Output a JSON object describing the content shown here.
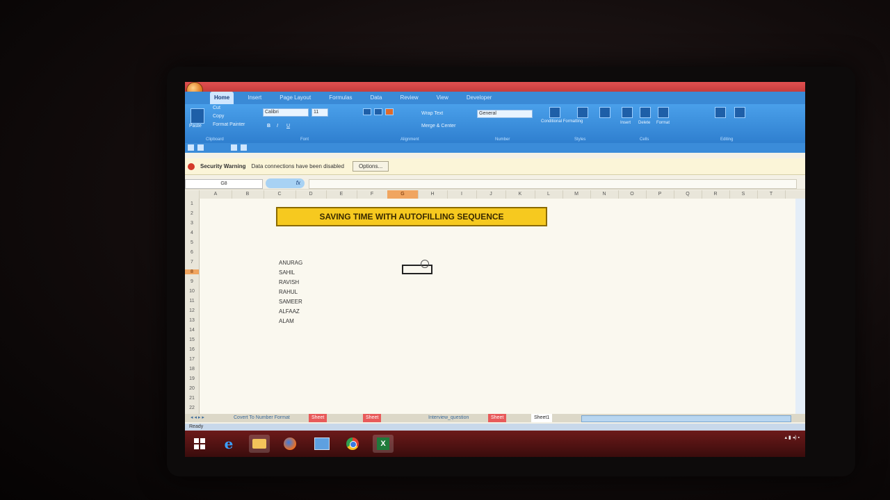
{
  "ribbon": {
    "tabs": [
      "Home",
      "Insert",
      "Page Layout",
      "Formulas",
      "Data",
      "Review",
      "View",
      "Developer"
    ],
    "active_tab": "Home",
    "clipboard": {
      "paste": "Paste",
      "cut": "Cut",
      "copy": "Copy",
      "format_painter": "Format Painter",
      "group": "Clipboard"
    },
    "font": {
      "name": "Calibri",
      "size": "11",
      "group": "Font"
    },
    "alignment": {
      "wrap_text": "Wrap Text",
      "merge_center": "Merge & Center",
      "group": "Alignment"
    },
    "number": {
      "format": "General",
      "group": "Number"
    },
    "styles": {
      "conditional": "Conditional Formatting",
      "format_table": "Format as Table",
      "cell_styles": "Cell Styles",
      "group": "Styles"
    },
    "cells": {
      "insert": "Insert",
      "delete": "Delete",
      "format": "Format",
      "group": "Cells"
    },
    "editing": {
      "sort_filter": "Sort & Filter",
      "find_select": "Find & Select",
      "group": "Editing"
    }
  },
  "security": {
    "title": "Security Warning",
    "message": "Data connections have been disabled",
    "options_label": "Options..."
  },
  "formula_bar": {
    "name_box": "G8",
    "fx": "fx",
    "value": ""
  },
  "columns": [
    "A",
    "B",
    "C",
    "D",
    "E",
    "F",
    "G",
    "H",
    "I",
    "J",
    "K",
    "L",
    "M",
    "N",
    "O",
    "P",
    "Q",
    "R",
    "S",
    "T"
  ],
  "selected_column": "G",
  "rows": [
    "1",
    "2",
    "3",
    "4",
    "5",
    "6",
    "7",
    "8",
    "9",
    "10",
    "11",
    "12",
    "13",
    "14",
    "15",
    "16",
    "17",
    "18",
    "19",
    "20",
    "21",
    "22"
  ],
  "selected_row": "8",
  "sheet": {
    "banner": "SAVING TIME WITH AUTOFILLING SEQUENCE",
    "names": [
      "ANURAG",
      "SAHIL",
      "RAVISH",
      "RAHUL",
      "SAMEER",
      "ALFAAZ",
      "ALAM"
    ]
  },
  "sheet_tabs": [
    {
      "label": "Covert To Number Format",
      "style": "normal"
    },
    {
      "label": "Sheet",
      "style": "red"
    },
    {
      "label": "Sheet",
      "style": "red"
    },
    {
      "label": "Interview_question",
      "style": "normal"
    },
    {
      "label": "Sheet",
      "style": "red"
    },
    {
      "label": "Sheet1",
      "style": "active"
    }
  ],
  "status": "Ready",
  "taskbar": {
    "apps": [
      "start-icon",
      "internet-explorer-icon",
      "file-explorer-icon",
      "firefox-icon",
      "media-icon",
      "chrome-icon",
      "excel-icon"
    ]
  },
  "colors": {
    "banner": "#f6c91f",
    "ribbon": "#3a8ad6",
    "selection": "#f0a560"
  }
}
